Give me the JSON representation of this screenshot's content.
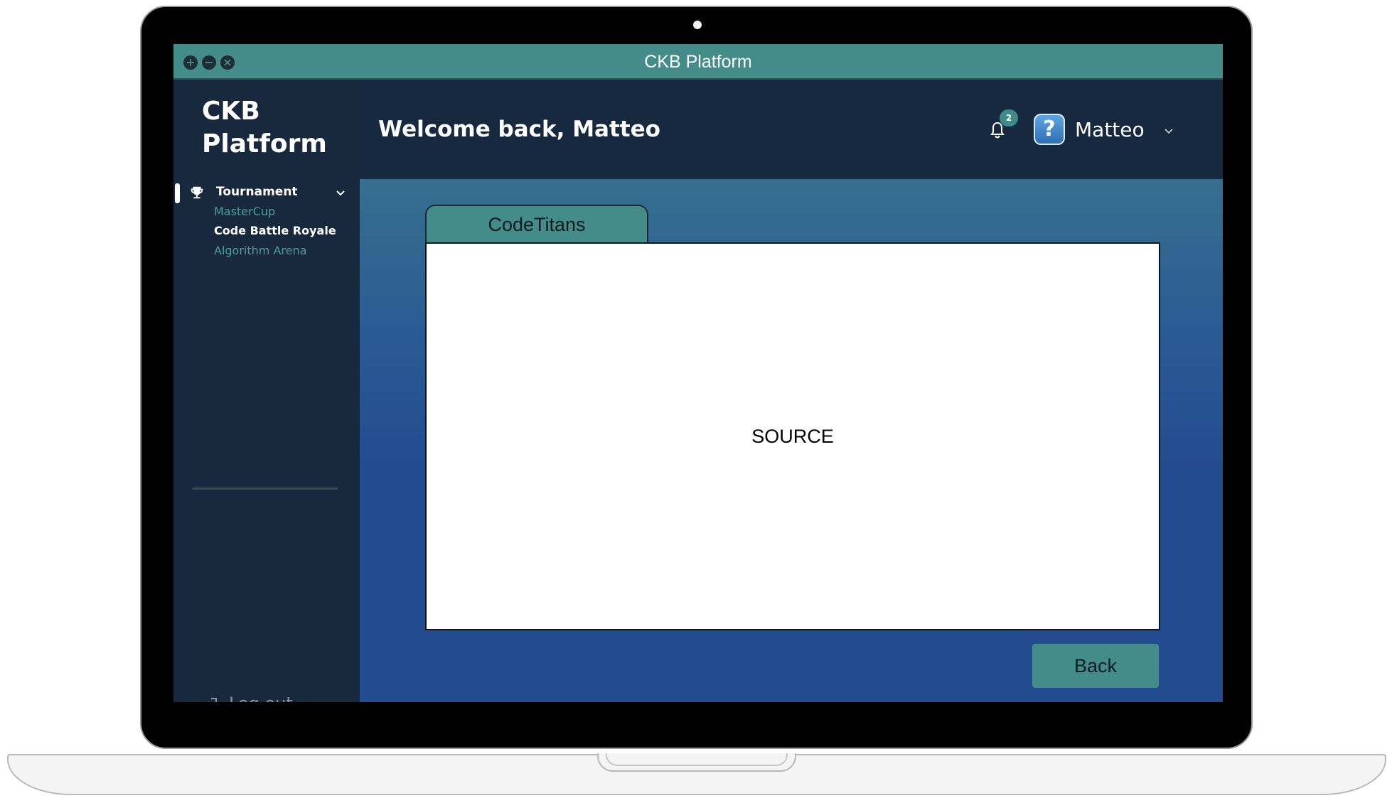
{
  "window": {
    "title": "CKB Platform",
    "controls": [
      "+",
      "−",
      "×"
    ]
  },
  "sidebar": {
    "brand": "CKB Platform",
    "group": {
      "label": "Tournament",
      "items": [
        {
          "label": "MasterCup",
          "active": false
        },
        {
          "label": "Code Battle Royale",
          "active": true
        },
        {
          "label": "Algorithm Arena",
          "active": false
        }
      ]
    },
    "logout_label": "Log out"
  },
  "header": {
    "welcome": "Welcome back, Matteo",
    "notification_count": "2",
    "user_name": "Matteo",
    "avatar_glyph": "?"
  },
  "main": {
    "tab_label": "CodeTitans",
    "panel_text": "SOURCE",
    "back_label": "Back"
  },
  "colors": {
    "accent_teal": "#448c89",
    "sidebar_bg": "#18293d",
    "main_blue": "#234b8f"
  }
}
